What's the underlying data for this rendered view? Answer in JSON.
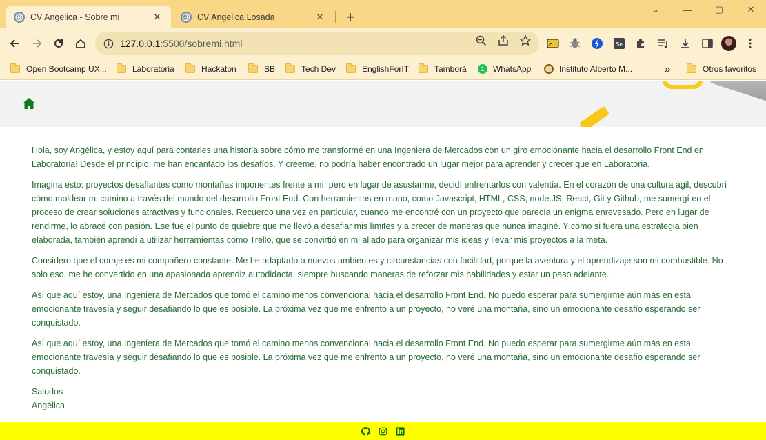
{
  "browser": {
    "tabs": [
      {
        "label": "CV Angelica - Sobre mi",
        "active": true
      },
      {
        "label": "CV Angelica Losada",
        "active": false
      }
    ],
    "url_host": "127.0.0.1",
    "url_rest": ":5500/sobremi.html",
    "bookmarks": [
      {
        "label": "Open Bootcamp UX...",
        "icon": "folder-icon"
      },
      {
        "label": "Laboratoria",
        "icon": "folder-icon"
      },
      {
        "label": "Hackaton",
        "icon": "folder-icon"
      },
      {
        "label": "SB",
        "icon": "folder-icon"
      },
      {
        "label": "Tech Dev",
        "icon": "folder-icon"
      },
      {
        "label": "EnglishForIT",
        "icon": "folder-icon"
      },
      {
        "label": "Tamborá",
        "icon": "folder-icon"
      },
      {
        "label": "WhatsApp",
        "icon": "whatsapp-icon"
      },
      {
        "label": "Instituto Alberto M...",
        "icon": "institute-icon"
      }
    ],
    "other_bookmarks": "Otros favoritos",
    "overflow_label": "»",
    "colors": {
      "frame": "#f8d787",
      "toolbar": "#fdf0d0"
    }
  },
  "page": {
    "paragraphs": [
      "Hola, soy Angélica, y estoy aquí para contarles una historia sobre cómo me transformé en una Ingeniera de Mercados con un giro emocionante hacia el desarrollo Front End en Laboratoria! Desde el principio, me han encantado los desafíos. Y créeme, no podría haber encontrado un lugar mejor para aprender y crecer que en Laboratoria.",
      "Imagina esto: proyectos desafiantes como montañas imponentes frente a mí, pero en lugar de asustarme, decidí enfrentarlos con valentía. En el corazón de una cultura ágil, descubrí cómo moldear mi camino a través del mundo del desarrollo Front End. Con herramientas en mano, como Javascript, HTML, CSS, node.JS, React, Git y Github, me sumergí en el proceso de crear soluciones atractivas y funcionales. Recuerdo una vez en particular, cuando me encontré con un proyecto que parecía un enigma enrevesado. Pero en lugar de rendirme, lo abracé con pasión. Ese fue el punto de quiebre que me llevó a desafiar mis límites y a crecer de maneras que nunca imaginé. Y como si fuera una estrategia bien elaborada, también aprendí a utilizar herramientas como Trello, que se convirtió en mi aliado para organizar mis ideas y llevar mis proyectos a la meta.",
      "Considero que el coraje es mi compañero constante. Me he adaptado a nuevos ambientes y circunstancias con facilidad, porque la aventura y el aprendizaje son mi combustible. No solo eso, me he convertido en una apasionada aprendiz autodidacta, siempre buscando maneras de reforzar mis habilidades y estar un paso adelante.",
      "Así que aquí estoy, una Ingeniera de Mercados que tomó el camino menos convencional hacia el desarrollo Front End. No puedo esperar para sumergirme aún más en esta emocionante travesía y seguir desafiando lo que es posible. La próxima vez que me enfrento a un proyecto, no veré una montaña, sino un emocionante desafío esperando ser conquistado.",
      "Así que aquí estoy, una Ingeniera de Mercados que tomó el camino menos convencional hacia el desarrollo Front End. No puedo esperar para sumergirme aún más en esta emocionante travesía y seguir desafiando lo que es posible. La próxima vez que me enfrento a un proyecto, no veré una montaña, sino un emocionante desafío esperando ser conquistado."
    ],
    "sign_off": "Saludos",
    "signature": "Angélica",
    "text_color": "#256b36",
    "footer_color": "#ffff00",
    "footer_icons": [
      "github-icon",
      "instagram-icon",
      "linkedin-icon"
    ]
  }
}
